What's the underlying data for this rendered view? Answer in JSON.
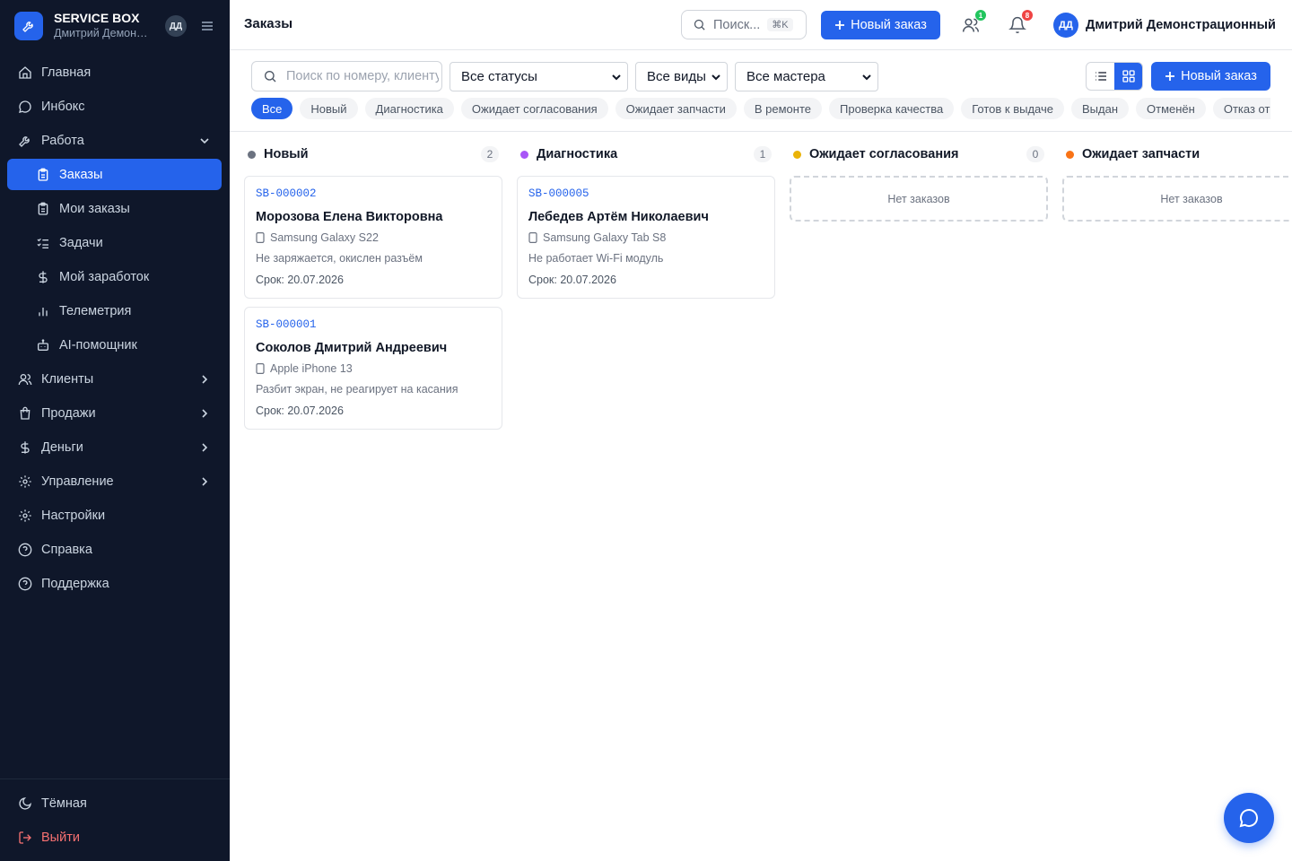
{
  "app": {
    "brand_title": "SERVICE BOX",
    "brand_user": "Дмитрий Демонстрационный",
    "brand_initials": "ДД"
  },
  "sidebar": {
    "items": [
      {
        "label": "Главная"
      },
      {
        "label": "Инбокс"
      },
      {
        "label": "Работа"
      },
      {
        "label": "Заказы"
      },
      {
        "label": "Мои заказы"
      },
      {
        "label": "Задачи"
      },
      {
        "label": "Мой заработок"
      },
      {
        "label": "Телеметрия"
      },
      {
        "label": "AI-помощник"
      },
      {
        "label": "Клиенты"
      },
      {
        "label": "Продажи"
      },
      {
        "label": "Деньги"
      },
      {
        "label": "Управление"
      },
      {
        "label": "Настройки"
      },
      {
        "label": "Справка"
      },
      {
        "label": "Поддержка"
      }
    ],
    "footer": {
      "theme_label": "Тёмная",
      "logout_label": "Выйти"
    }
  },
  "header": {
    "title": "Заказы",
    "search_label": "Поиск...",
    "search_kbd": "⌘K",
    "new_order_label": "Новый заказ",
    "team_badge": "1",
    "notif_badge": "8",
    "user_initials": "ДД",
    "user_name": "Дмитрий Демонстрационный"
  },
  "filters": {
    "search_placeholder": "Поиск по номеру, клиенту",
    "status_select": "Все статусы",
    "type_select": "Все виды",
    "master_select": "Все мастера",
    "new_order_label": "Новый заказ",
    "chips": [
      "Все",
      "Новый",
      "Диагностика",
      "Ожидает согласования",
      "Ожидает запчасти",
      "В ремонте",
      "Проверка качества",
      "Готов к выдаче",
      "Выдан",
      "Отменён",
      "Отказ от ремонта"
    ]
  },
  "board": {
    "empty_label": "Нет заказов",
    "columns": [
      {
        "title": "Новый",
        "count": "2",
        "color": "#6b7280",
        "cards": [
          {
            "number": "SB-000002",
            "client": "Морозова Елена Викторовна",
            "device": "Samsung Galaxy S22",
            "problem": "Не заряжается, окислен разъём",
            "due": "Срок: 20.07.2026"
          },
          {
            "number": "SB-000001",
            "client": "Соколов Дмитрий Андреевич",
            "device": "Apple iPhone 13",
            "problem": "Разбит экран, не реагирует на касания",
            "due": "Срок: 20.07.2026"
          }
        ]
      },
      {
        "title": "Диагностика",
        "count": "1",
        "color": "#a855f7",
        "cards": [
          {
            "number": "SB-000005",
            "client": "Лебедев Артём Николаевич",
            "device": "Samsung Galaxy Tab S8",
            "problem": "Не работает Wi-Fi модуль",
            "due": "Срок: 20.07.2026"
          }
        ]
      },
      {
        "title": "Ожидает согласования",
        "count": "0",
        "color": "#eab308",
        "cards": []
      },
      {
        "title": "Ожидает запчасти",
        "color": "#f97316",
        "cards": []
      }
    ]
  },
  "colors": {
    "accent": "#2563eb",
    "sidebar_bg": "#0f172a",
    "danger": "#f87171",
    "team_badge": "#22c55e",
    "notif_badge": "#ef4444"
  }
}
